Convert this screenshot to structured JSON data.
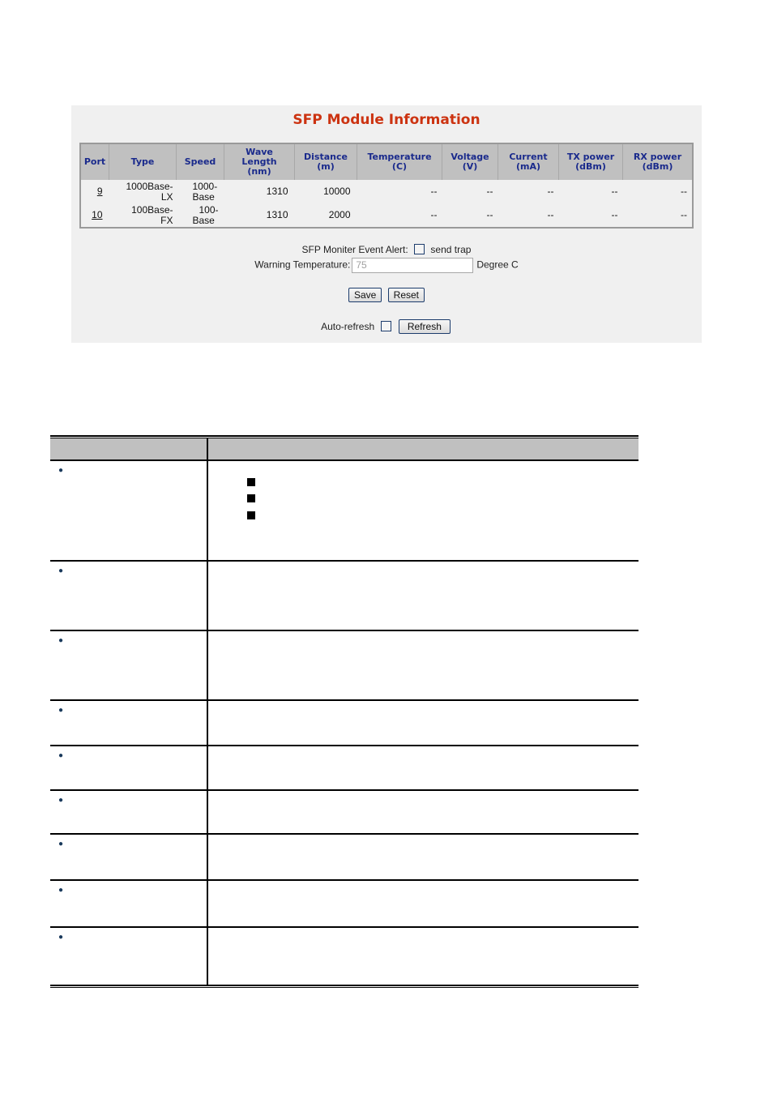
{
  "panel": {
    "title": "SFP Module Information",
    "title_color": "#cc3311",
    "header_color": "#1a2a8c",
    "columns": [
      [
        "Port"
      ],
      [
        "Type"
      ],
      [
        "Speed"
      ],
      [
        "Wave",
        "Length",
        "(nm)"
      ],
      [
        "Distance",
        "(m)"
      ],
      [
        "Temperature",
        "(C)"
      ],
      [
        "Voltage",
        "(V)"
      ],
      [
        "Current",
        "(mA)"
      ],
      [
        "TX power",
        "(dBm)"
      ],
      [
        "RX power",
        "(dBm)"
      ]
    ],
    "rows": [
      {
        "port": "9",
        "type": [
          "1000Base-",
          "LX"
        ],
        "speed": [
          "1000-",
          "Base"
        ],
        "wavelength": "1310",
        "distance": "10000",
        "temperature": "--",
        "voltage": "--",
        "current": "--",
        "tx_power": "--",
        "rx_power": "--"
      },
      {
        "port": "10",
        "type": [
          "100Base-",
          "FX"
        ],
        "speed": [
          "100-",
          "Base"
        ],
        "wavelength": "1310",
        "distance": "2000",
        "temperature": "--",
        "voltage": "--",
        "current": "--",
        "tx_power": "--",
        "rx_power": "--"
      }
    ],
    "event_alert_label": "SFP Moniter Event Alert:",
    "send_trap_label": "send trap",
    "send_trap_checked": false,
    "warning_temp_label": "Warning Temperature:",
    "warning_temp_value": "75",
    "warning_temp_unit": "Degree C",
    "save_label": "Save",
    "reset_label": "Reset",
    "auto_refresh_label": "Auto-refresh",
    "auto_refresh_checked": false,
    "refresh_label": "Refresh"
  },
  "description_table": {
    "rows": 9
  }
}
